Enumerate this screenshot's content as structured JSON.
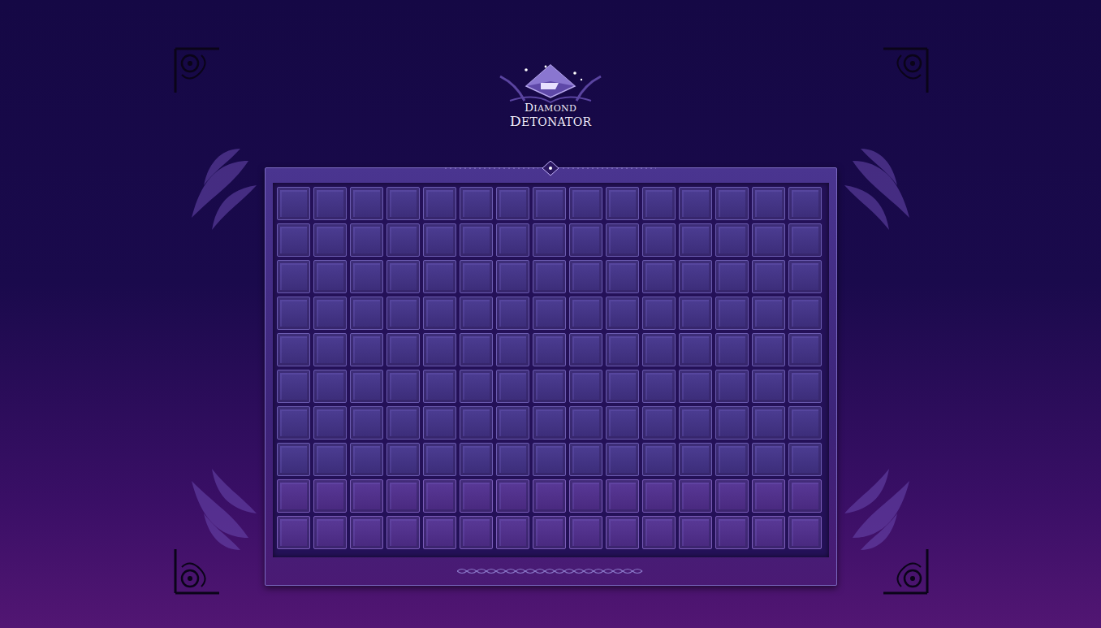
{
  "logo": {
    "line1": "DIAMOND",
    "line2": "DETONATOR"
  },
  "board": {
    "rows": [
      [
        {
          "covered": true
        },
        {
          "covered": true
        },
        {
          "covered": true
        },
        {
          "covered": true
        },
        {
          "covered": true
        },
        {
          "covered": true
        },
        {
          "covered": true
        },
        {
          "covered": true
        },
        {
          "covered": true
        },
        {
          "covered": true
        },
        {
          "covered": true
        },
        {
          "covered": true
        },
        {
          "covered": true
        },
        {
          "covered": true
        },
        {
          "covered": true
        }
      ],
      [
        {
          "covered": true
        },
        {
          "covered": true
        },
        {
          "covered": true
        },
        {
          "covered": true
        },
        {
          "covered": true
        },
        {
          "covered": true
        },
        {
          "covered": true
        },
        {
          "covered": true
        },
        {
          "covered": true
        },
        {
          "covered": true
        },
        {
          "covered": true
        },
        {
          "covered": true
        },
        {
          "covered": true
        },
        {
          "covered": true
        },
        {
          "covered": true
        }
      ],
      [
        {
          "covered": true
        },
        {
          "covered": true
        },
        {
          "covered": true
        },
        {
          "covered": true
        },
        {
          "covered": true
        },
        {
          "covered": true
        },
        {
          "covered": true
        },
        {
          "covered": true
        },
        {
          "covered": true
        },
        {
          "covered": true
        },
        {
          "covered": true
        },
        {
          "covered": true
        },
        {
          "covered": true
        },
        {
          "covered": true
        },
        {
          "covered": true
        }
      ],
      [
        {
          "covered": true
        },
        {
          "covered": true
        },
        {
          "covered": true
        },
        {
          "covered": true
        },
        {
          "covered": true
        },
        {
          "covered": true
        },
        {
          "covered": true
        },
        {
          "covered": true
        },
        {
          "covered": true
        },
        {
          "covered": true
        },
        {
          "covered": true
        },
        {
          "covered": true
        },
        {
          "covered": true
        },
        {
          "covered": true
        },
        {
          "covered": true
        }
      ],
      [
        {
          "covered": true
        },
        {
          "covered": true
        },
        {
          "covered": true
        },
        {
          "covered": true
        },
        {
          "covered": true
        },
        {
          "covered": true
        },
        {
          "covered": true
        },
        {
          "covered": true
        },
        {
          "covered": true
        },
        {
          "covered": true
        },
        {
          "covered": true
        },
        {
          "covered": true
        },
        {
          "covered": true
        },
        {
          "covered": true
        },
        {
          "covered": true
        }
      ],
      [
        {
          "covered": true
        },
        {
          "covered": true
        },
        {
          "covered": true
        },
        {
          "covered": true
        },
        {
          "covered": true
        },
        {
          "covered": true
        },
        {
          "covered": true
        },
        {
          "covered": true
        },
        {
          "covered": true
        },
        {
          "covered": true
        },
        {
          "covered": true
        },
        {
          "covered": true
        },
        {
          "covered": true
        },
        {
          "covered": true
        },
        {
          "covered": true
        }
      ],
      [
        {
          "covered": true
        },
        {
          "covered": true
        },
        {
          "covered": true
        },
        {
          "covered": true
        },
        {
          "covered": true
        },
        {
          "covered": true
        },
        {
          "covered": true
        },
        {
          "covered": true
        },
        {
          "covered": true
        },
        {
          "covered": true
        },
        {
          "covered": true
        },
        {
          "covered": true
        },
        {
          "covered": true
        },
        {
          "covered": true
        },
        {
          "covered": true
        }
      ],
      [
        {
          "covered": true
        },
        {
          "covered": true
        },
        {
          "covered": true
        },
        {
          "covered": true
        },
        {
          "covered": true
        },
        {
          "covered": true
        },
        {
          "covered": true
        },
        {
          "covered": true
        },
        {
          "covered": true
        },
        {
          "covered": true
        },
        {
          "covered": true
        },
        {
          "covered": true
        },
        {
          "covered": true
        },
        {
          "covered": true
        },
        {
          "covered": true
        }
      ],
      [
        {
          "covered": true
        },
        {
          "covered": true
        },
        {
          "covered": true
        },
        {
          "covered": true
        },
        {
          "covered": true
        },
        {
          "covered": true
        },
        {
          "covered": true
        },
        {
          "covered": true
        },
        {
          "covered": true
        },
        {
          "covered": true
        },
        {
          "covered": true
        },
        {
          "covered": true
        },
        {
          "covered": true
        },
        {
          "covered": true
        },
        {
          "covered": true
        }
      ],
      [
        {
          "covered": true
        },
        {
          "covered": true
        },
        {
          "covered": true
        },
        {
          "covered": true
        },
        {
          "covered": true
        },
        {
          "covered": true
        },
        {
          "covered": true
        },
        {
          "covered": true
        },
        {
          "covered": true
        },
        {
          "covered": true
        },
        {
          "covered": true
        },
        {
          "covered": true
        },
        {
          "covered": true
        },
        {
          "covered": true
        },
        {
          "covered": true
        }
      ]
    ]
  }
}
